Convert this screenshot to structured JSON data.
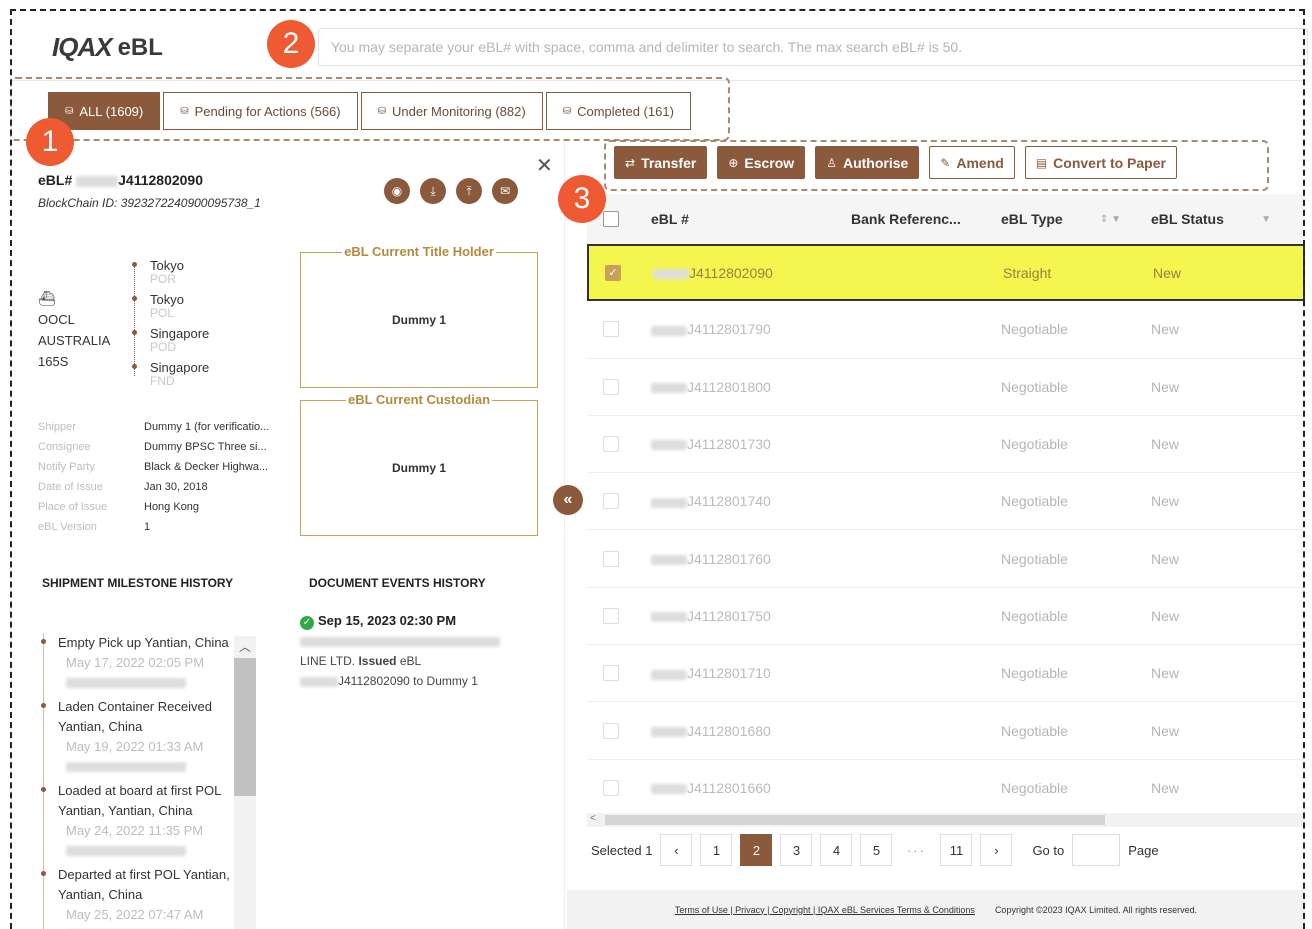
{
  "header": {
    "logo_mark": "IQAX",
    "logo_suffix": "eBL",
    "search_placeholder": "You may separate your eBL# with space, comma and delimiter to search. The max search eBL# is 50."
  },
  "callouts": [
    "1",
    "2",
    "3"
  ],
  "tabs": [
    {
      "label": "ALL (1609)",
      "active": true
    },
    {
      "label": "Pending for Actions (566)",
      "active": false
    },
    {
      "label": "Under Monitoring (882)",
      "active": false
    },
    {
      "label": "Completed (161)",
      "active": false
    }
  ],
  "detail": {
    "ebl_prefix": "eBL#",
    "ebl_suffix": "J4112802090",
    "blockchain_id": "BlockChain ID: 3923272240900095738_1",
    "vessel": [
      "OOCL",
      "AUSTRALIA",
      "165S"
    ],
    "route": [
      {
        "city": "Tokyo",
        "code": "POR"
      },
      {
        "city": "Tokyo",
        "code": "POL"
      },
      {
        "city": "Singapore",
        "code": "POD"
      },
      {
        "city": "Singapore",
        "code": "FND"
      }
    ],
    "title_holder_label": "eBL Current Title Holder",
    "title_holder_value": "Dummy 1",
    "custodian_label": "eBL Current Custodian",
    "custodian_value": "Dummy 1",
    "fields": [
      {
        "label": "Shipper",
        "value": "Dummy 1 (for verificatio..."
      },
      {
        "label": "Consignee",
        "value": "Dummy BPSC Three si..."
      },
      {
        "label": "Notify Party",
        "value": "Black & Decker Highwa..."
      },
      {
        "label": "Date of Issue",
        "value": "Jan 30, 2018"
      },
      {
        "label": "Place of Issue",
        "value": "Hong Kong"
      },
      {
        "label": "eBL Version",
        "value": "1"
      }
    ],
    "milestone_title": "SHIPMENT MILESTONE HISTORY",
    "milestones": [
      {
        "title": "Empty Pick up Yantian, China",
        "time": "May 17, 2022 02:05 PM"
      },
      {
        "title": "Laden Container Received Yantian, China",
        "time": "May 19, 2022 01:33 AM"
      },
      {
        "title": "Loaded at board at first POL Yantian, Yantian, China",
        "time": "May 24, 2022 11:35 PM"
      },
      {
        "title": "Departed at first POL Yantian, Yantian, China",
        "time": "May 25, 2022 07:47 AM"
      }
    ],
    "events_title": "DOCUMENT EVENTS HISTORY",
    "event_time": "Sep 15, 2023 02:30 PM",
    "event_line1_suffix": "LINE LTD.",
    "event_line1_action": "Issued",
    "event_line1_end": "eBL",
    "event_line2": "J4112802090 to Dummy 1"
  },
  "actions": [
    {
      "label": "Transfer",
      "icon": "transfer-icon",
      "glyph": "⇄",
      "style": "filled"
    },
    {
      "label": "Escrow",
      "icon": "escrow-icon",
      "glyph": "⊕",
      "style": "filled"
    },
    {
      "label": "Authorise",
      "icon": "authorise-icon",
      "glyph": "♙",
      "style": "filled"
    },
    {
      "label": "Amend",
      "icon": "amend-icon",
      "glyph": "✎",
      "style": "outline"
    },
    {
      "label": "Convert to Paper",
      "icon": "document-icon",
      "glyph": "▤",
      "style": "outline"
    }
  ],
  "table": {
    "columns": [
      "eBL #",
      "Bank Referenc...",
      "eBL Type",
      "eBL Status"
    ],
    "rows": [
      {
        "ebl": "J4112802090",
        "bank": "",
        "type": "Straight",
        "status": "New",
        "selected": true
      },
      {
        "ebl": "J4112801790",
        "bank": "",
        "type": "Negotiable",
        "status": "New",
        "selected": false
      },
      {
        "ebl": "J4112801800",
        "bank": "",
        "type": "Negotiable",
        "status": "New",
        "selected": false
      },
      {
        "ebl": "J4112801730",
        "bank": "",
        "type": "Negotiable",
        "status": "New",
        "selected": false
      },
      {
        "ebl": "J4112801740",
        "bank": "",
        "type": "Negotiable",
        "status": "New",
        "selected": false
      },
      {
        "ebl": "J4112801760",
        "bank": "",
        "type": "Negotiable",
        "status": "New",
        "selected": false
      },
      {
        "ebl": "J4112801750",
        "bank": "",
        "type": "Negotiable",
        "status": "New",
        "selected": false
      },
      {
        "ebl": "J4112801710",
        "bank": "",
        "type": "Negotiable",
        "status": "New",
        "selected": false
      },
      {
        "ebl": "J4112801680",
        "bank": "",
        "type": "Negotiable",
        "status": "New",
        "selected": false
      },
      {
        "ebl": "J4112801660",
        "bank": "",
        "type": "Negotiable",
        "status": "New",
        "selected": false
      }
    ]
  },
  "pagination": {
    "selected_text": "Selected 1",
    "pages": [
      "1",
      "2",
      "3",
      "4",
      "5"
    ],
    "current": "2",
    "last": "11",
    "ellipsis": "···",
    "goto_label": "Go to",
    "page_label": "Page"
  },
  "footer": {
    "links": "Terms of Use | Privacy | Copyright | IQAX eBL Services Terms & Conditions",
    "copyright": "Copyright ©2023 IQAX Limited. All rights reserved."
  },
  "colors": {
    "brand": "#8b5a3c",
    "highlight": "#f5f550",
    "gold": "#c9a25a",
    "callout": "#ee5a31"
  }
}
